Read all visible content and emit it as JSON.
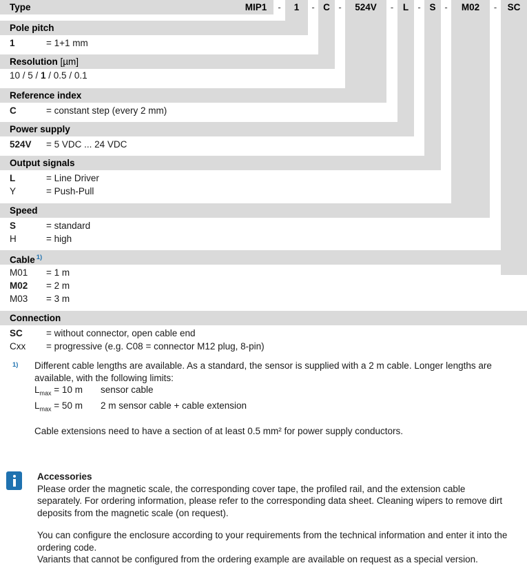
{
  "ordering_code": {
    "segments": [
      {
        "code": "MIP1"
      },
      {
        "code": "1"
      },
      {
        "code": "C"
      },
      {
        "code": "524V"
      },
      {
        "code": "L"
      },
      {
        "code": "S"
      },
      {
        "code": "M02"
      },
      {
        "code": "SC"
      }
    ],
    "separator": "-"
  },
  "sections": [
    {
      "title": "Type",
      "options": []
    },
    {
      "title": "Pole pitch",
      "options": [
        {
          "code": "1",
          "desc": "= 1+1 mm",
          "selected": true
        }
      ]
    },
    {
      "title": "Resolution",
      "unit": "[µm]",
      "inline_values": "10 / 5 / 1 / 0.5 / 0.1",
      "inline_selected": "1",
      "options": []
    },
    {
      "title": "Reference index",
      "options": [
        {
          "code": "C",
          "desc": "= constant step (every 2 mm)",
          "selected": true
        }
      ]
    },
    {
      "title": "Power supply",
      "options": [
        {
          "code": "524V",
          "desc": "= 5 VDC ... 24 VDC",
          "selected": true
        }
      ]
    },
    {
      "title": "Output signals",
      "options": [
        {
          "code": "L",
          "desc": "= Line Driver",
          "selected": true
        },
        {
          "code": "Y",
          "desc": "= Push-Pull",
          "selected": false
        }
      ]
    },
    {
      "title": "Speed",
      "options": [
        {
          "code": "S",
          "desc": "= standard",
          "selected": true
        },
        {
          "code": "H",
          "desc": "= high",
          "selected": false
        }
      ]
    },
    {
      "title": "Cable",
      "footnote_marker": "1)",
      "options": [
        {
          "code": "M01",
          "desc": "= 1 m",
          "selected": false
        },
        {
          "code": "M02",
          "desc": "= 2 m",
          "selected": true
        },
        {
          "code": "M03",
          "desc": "= 3 m",
          "selected": false
        }
      ]
    },
    {
      "title": "Connection",
      "options": [
        {
          "code": "SC",
          "desc": "= without connector, open cable end",
          "selected": true
        },
        {
          "code": "Cxx",
          "desc": "= progressive (e.g. C08 = connector M12 plug, 8-pin)",
          "selected": false
        }
      ]
    }
  ],
  "footnote": {
    "marker": "1)",
    "paragraph": "Different cable lengths are available. As a standard, the sensor is supplied with a 2 m cable. Longer lengths are available, with the following limits:",
    "limits": [
      {
        "label": "Lmax",
        "value": "= 10 m",
        "note": "sensor cable"
      },
      {
        "label": "Lmax",
        "value": "= 50 m",
        "note": "2 m sensor cable + cable extension"
      }
    ],
    "closing": "Cable extensions need to have a section of at least 0.5 mm² for power supply conductors."
  },
  "accessories": {
    "icon": "info-icon",
    "title": "Accessories",
    "paragraph1": "Please order the magnetic scale, the corresponding cover tape, the profiled rail, and the extension cable separately. For ordering information, please refer to the corresponding data sheet. Cleaning wipers to remove dirt deposits from the magnetic scale (on request).",
    "paragraph2": "You can configure the enclosure according to your requirements from the technical information and enter it into the ordering code.",
    "paragraph3": "Variants that cannot be configured from the ordering example are available on request as a special version."
  },
  "colors": {
    "accent_blue": "#1F72B0",
    "bar_gray": "#dadada"
  }
}
